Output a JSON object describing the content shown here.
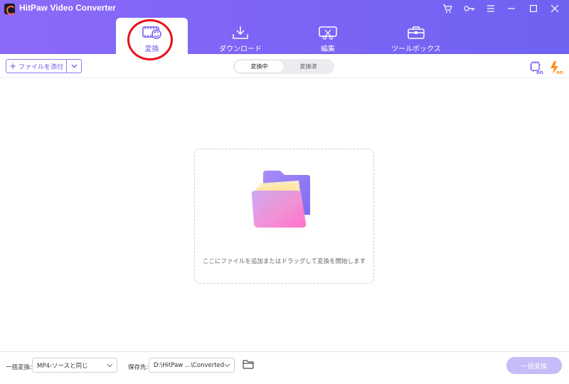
{
  "app": {
    "title": "HitPaw Video Converter"
  },
  "tabs": [
    {
      "label": "変換",
      "icon": "convert-icon",
      "active": true
    },
    {
      "label": "ダウンロード",
      "icon": "download-icon",
      "active": false
    },
    {
      "label": "編集",
      "icon": "edit-icon",
      "active": false
    },
    {
      "label": "ツールボックス",
      "icon": "toolbox-icon",
      "active": false
    }
  ],
  "toolbar": {
    "add_file_label": "ファイルを添付",
    "segments": [
      "変換中",
      "変換済"
    ],
    "active_segment": "変換中",
    "hardware_accel_icon": "cpu-on-icon",
    "speed_boost_icon": "lightning-on-icon"
  },
  "dropzone": {
    "hint": "ここにファイルを追加またはドラッグして変換を開始します"
  },
  "footer": {
    "batch_label": "一括変換:",
    "batch_format": "MP4-ソースと同じ",
    "save_label": "保存先:",
    "save_path": "D:\\HitPaw ...\\Converted",
    "convert_all_label": "一括変換"
  },
  "colors": {
    "accent": "#7e64f6",
    "annotation_circle": "#e8101a",
    "speed_icon": "#ff8c1a"
  }
}
